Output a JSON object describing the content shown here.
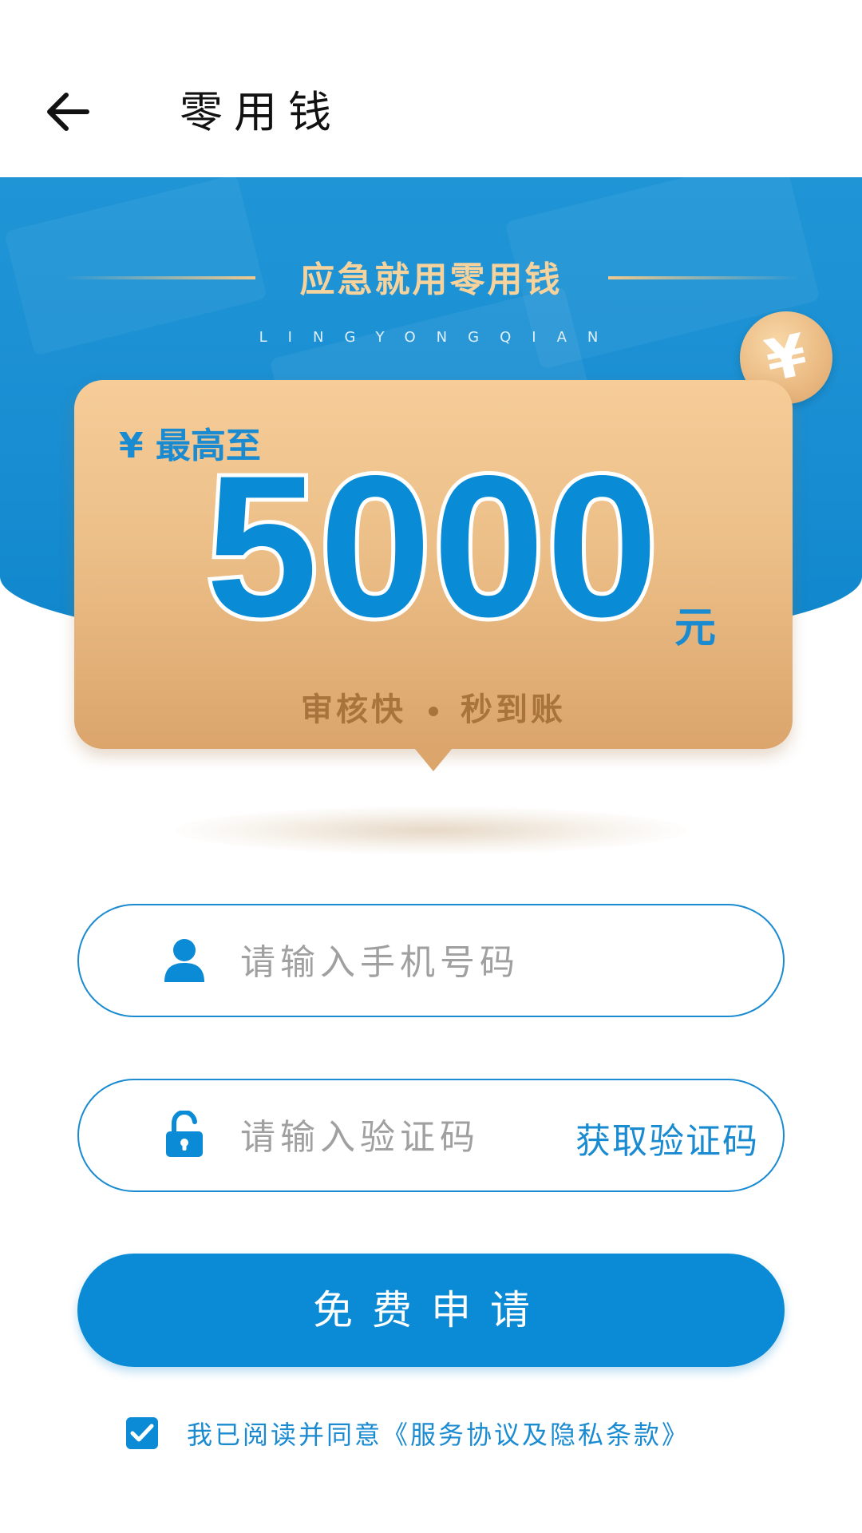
{
  "header": {
    "title": "零用钱",
    "back_icon": "arrow-left-icon"
  },
  "banner": {
    "slogan": "应急就用零用钱",
    "subslogan": "LINGYONGQIAN",
    "coin_symbol": "¥"
  },
  "card": {
    "label": "¥ 最高至",
    "amount": "5000",
    "unit": "元",
    "feature_left": "审核快",
    "feature_right": "秒到账"
  },
  "form": {
    "phone": {
      "icon": "user-icon",
      "placeholder": "请输入手机号码",
      "value": ""
    },
    "code": {
      "icon": "unlock-icon",
      "placeholder": "请输入验证码",
      "value": "",
      "get_code_label": "获取验证码"
    },
    "submit_label": "免费申请"
  },
  "agreement": {
    "checked": true,
    "text": "我已阅读并同意",
    "link": "《服务协议及隐私条款》"
  },
  "colors": {
    "primary": "#0b8ad5",
    "banner": "#1a8ed2",
    "card_gold": "#ecbf88",
    "card_text_brown": "#a8733c"
  }
}
